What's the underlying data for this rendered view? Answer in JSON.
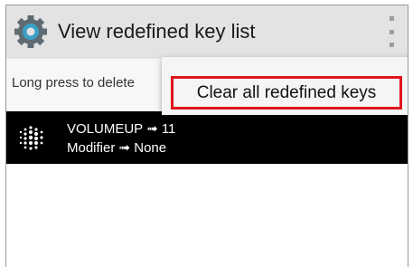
{
  "app": {
    "title": "View redefined key list",
    "icon": "gear-icon",
    "menu_icon": "overflow-menu-icon"
  },
  "hint_text": "Long press to delete",
  "list": {
    "items": [
      {
        "icon": "dot-grid-icon",
        "key_line": "VOLUMEUP ➟ 11",
        "modifier_line": "Modifier ➟ None"
      }
    ]
  },
  "popup_menu": {
    "items": [
      {
        "label": "Clear all redefined keys"
      }
    ],
    "highlight_color": "#e0141e"
  },
  "colors": {
    "actionbar": "#e3e3e3",
    "row_background": "#000000",
    "accent_icon": "#3aa0c8"
  }
}
